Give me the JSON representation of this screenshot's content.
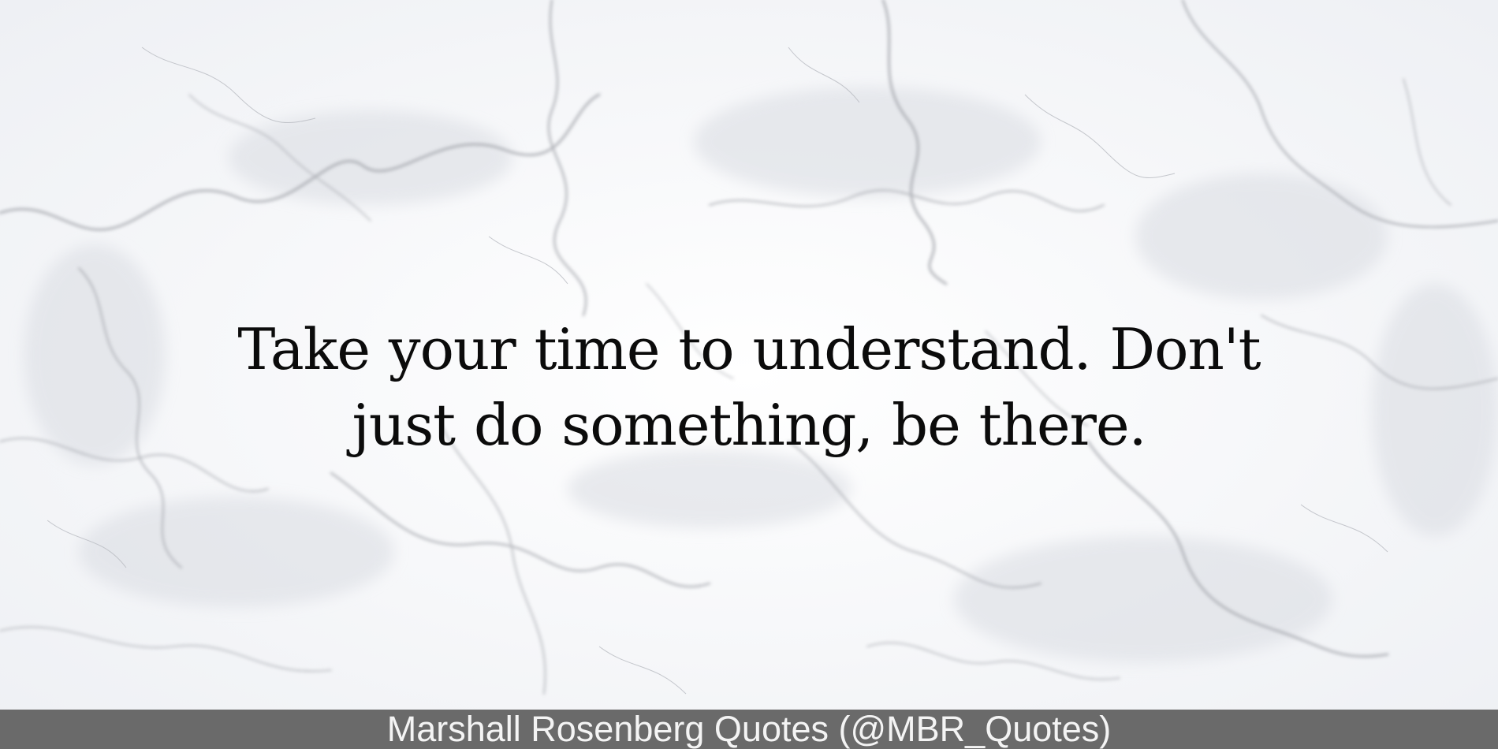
{
  "quote": {
    "line1": "Take your time to understand. Don't",
    "line2": "just do something, be there."
  },
  "footer": {
    "attribution": "Marshall Rosenberg Quotes (@MBR_Quotes)"
  },
  "colors": {
    "background": "#f6f7f9",
    "vein": "#9a9ca3",
    "text": "#0b0b0b",
    "footer_bg": "#6a6a6a",
    "footer_text": "#f4f4f4"
  }
}
